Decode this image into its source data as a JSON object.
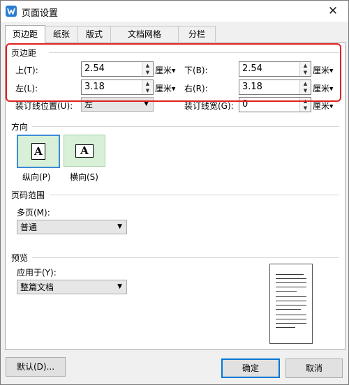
{
  "window": {
    "title": "页面设置",
    "app_icon": "wps-writer-icon",
    "close_glyph": "✕"
  },
  "tabs": [
    {
      "label": "页边距",
      "active": true
    },
    {
      "label": "纸张",
      "active": false
    },
    {
      "label": "版式",
      "active": false
    },
    {
      "label": "文档网格",
      "active": false
    },
    {
      "label": "分栏",
      "active": false
    }
  ],
  "margins": {
    "section_title": "页边距",
    "top": {
      "label": "上(T):",
      "value": "2.54",
      "unit": "厘米"
    },
    "bottom": {
      "label": "下(B):",
      "value": "2.54",
      "unit": "厘米"
    },
    "left": {
      "label": "左(L):",
      "value": "3.18",
      "unit": "厘米"
    },
    "right": {
      "label": "右(R):",
      "value": "3.18",
      "unit": "厘米"
    },
    "gutter_position": {
      "label": "装订线位置(U):",
      "value": "左"
    },
    "gutter_width": {
      "label": "装订线宽(G):",
      "value": "0",
      "unit": "厘米"
    }
  },
  "orientation": {
    "section_title": "方向",
    "portrait": {
      "label": "纵向(P)",
      "glyph": "A",
      "selected": true
    },
    "landscape": {
      "label": "横向(S)",
      "glyph": "A",
      "selected": false
    }
  },
  "pages": {
    "section_title": "页码范围",
    "multiple_label": "多页(M):",
    "multiple_value": "普通"
  },
  "preview": {
    "section_title": "预览",
    "apply_label": "应用于(Y):",
    "apply_value": "整篇文档"
  },
  "buttons": {
    "default": "默认(D)...",
    "ok": "确定",
    "cancel": "取消"
  },
  "colors": {
    "highlight": "#e02020",
    "accent": "#0078d7",
    "orientation_bg": "#d7f0d7"
  }
}
